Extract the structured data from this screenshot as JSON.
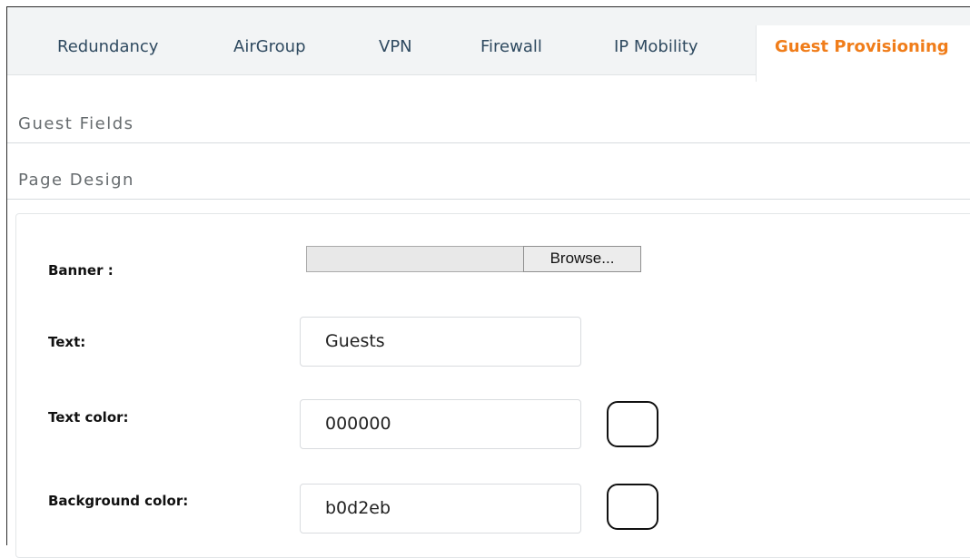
{
  "tabs": [
    {
      "label": "Redundancy"
    },
    {
      "label": "AirGroup"
    },
    {
      "label": "VPN"
    },
    {
      "label": "Firewall"
    },
    {
      "label": "IP Mobility"
    },
    {
      "label": "Guest Provisioning",
      "active": true
    }
  ],
  "sections": {
    "guest_fields": "Guest Fields",
    "page_design": "Page Design"
  },
  "form": {
    "banner_label": "Banner :",
    "browse_label": "Browse...",
    "text_label": "Text:",
    "text_value": "Guests",
    "text_color_label": "Text color:",
    "text_color_value": "000000",
    "background_color_label": "Background color:",
    "background_color_value": "b0d2eb"
  }
}
